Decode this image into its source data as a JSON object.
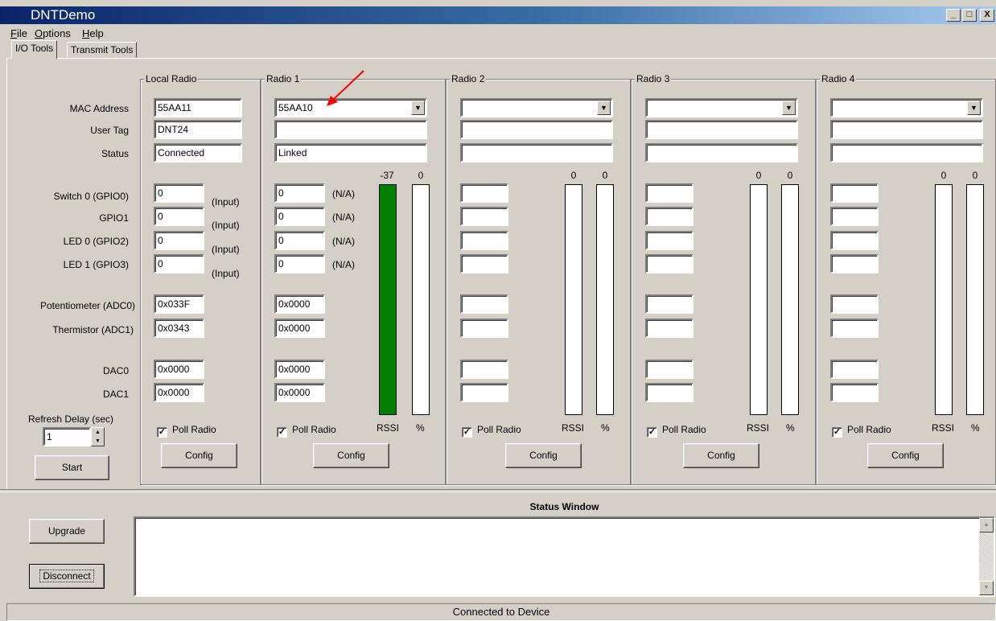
{
  "window": {
    "title": "DNTDemo",
    "minimize_glyph": "_",
    "maximize_glyph": "□",
    "close_glyph": "X"
  },
  "menu": [
    {
      "label": "File",
      "mnemonic": "F",
      "rest": "ile"
    },
    {
      "label": "Options",
      "mnemonic": "O",
      "rest": "ptions"
    },
    {
      "label": "Help",
      "mnemonic": "H",
      "rest": "elp"
    }
  ],
  "tabs": {
    "active": "I/O Tools",
    "other": "Transmit Tools"
  },
  "row_labels": {
    "mac_address": "MAC Address",
    "user_tag": "User Tag",
    "status": "Status",
    "gpio0": "Switch 0 (GPIO0)",
    "gpio1": "GPIO1",
    "gpio2": "LED 0 (GPIO2)",
    "gpio3": "LED 1 (GPIO3)",
    "adc0": "Potentiometer (ADC0)",
    "adc1": "Thermistor (ADC1)",
    "dac0": "DAC0",
    "dac1": "DAC1",
    "refresh_delay": "Refresh Delay (sec)"
  },
  "refresh": {
    "value": "1",
    "start_label": "Start"
  },
  "local_radio": {
    "title": "Local Radio",
    "mac": "55AA11",
    "user_tag": "DNT24",
    "status": "Connected",
    "gpio": [
      "0",
      "0",
      "0",
      "0"
    ],
    "gpio_mode": [
      "(Input)",
      "(Input)",
      "(Input)",
      "(Input)"
    ],
    "adc": [
      "0x033F",
      "0x0343"
    ],
    "dac": [
      "0x0000",
      "0x0000"
    ],
    "poll_label": "Poll Radio",
    "poll_checked": true,
    "check_glyph": "✓",
    "config_label": "Config"
  },
  "radios": [
    {
      "title": "Radio 1",
      "mac": "55AA10",
      "user_tag": "",
      "status": "Linked",
      "gpio": [
        "0",
        "0",
        "0",
        "0"
      ],
      "gpio_mode": [
        "(N/A)",
        "(N/A)",
        "(N/A)",
        "(N/A)"
      ],
      "adc": [
        "0x0000",
        "0x0000"
      ],
      "dac": [
        "0x0000",
        "0x0000"
      ],
      "rssi_value": "-37",
      "percent_value": "0",
      "rssi_fill": 1.0,
      "percent_fill": 0,
      "rssi_label": "RSSI",
      "percent_label": "%",
      "poll_label": "Poll Radio",
      "poll_checked": true,
      "config_label": "Config"
    },
    {
      "title": "Radio 2",
      "mac": "",
      "user_tag": "",
      "status": "",
      "gpio": [
        "",
        "",
        "",
        ""
      ],
      "gpio_mode": [
        "",
        "",
        "",
        ""
      ],
      "adc": [
        "",
        ""
      ],
      "dac": [
        "",
        ""
      ],
      "rssi_value": "0",
      "percent_value": "0",
      "rssi_fill": 0,
      "percent_fill": 0,
      "rssi_label": "RSSI",
      "percent_label": "%",
      "poll_label": "Poll Radio",
      "poll_checked": true,
      "config_label": "Config"
    },
    {
      "title": "Radio 3",
      "mac": "",
      "user_tag": "",
      "status": "",
      "gpio": [
        "",
        "",
        "",
        ""
      ],
      "gpio_mode": [
        "",
        "",
        "",
        ""
      ],
      "adc": [
        "",
        ""
      ],
      "dac": [
        "",
        ""
      ],
      "rssi_value": "0",
      "percent_value": "0",
      "rssi_fill": 0,
      "percent_fill": 0,
      "rssi_label": "RSSI",
      "percent_label": "%",
      "poll_label": "Poll Radio",
      "poll_checked": true,
      "config_label": "Config"
    },
    {
      "title": "Radio 4",
      "mac": "",
      "user_tag": "",
      "status": "",
      "gpio": [
        "",
        "",
        "",
        ""
      ],
      "gpio_mode": [
        "",
        "",
        "",
        ""
      ],
      "adc": [
        "",
        ""
      ],
      "dac": [
        "",
        ""
      ],
      "rssi_value": "0",
      "percent_value": "0",
      "rssi_fill": 0,
      "percent_fill": 0,
      "rssi_label": "RSSI",
      "percent_label": "%",
      "poll_label": "Poll Radio",
      "poll_checked": true,
      "config_label": "Config"
    }
  ],
  "status_window": {
    "title": "Status Window",
    "content": ""
  },
  "buttons": {
    "upgrade": "Upgrade",
    "disconnect": "Disconnect"
  },
  "statusbar": {
    "text": "Connected to Device"
  },
  "colors": {
    "rssi_bar": "#008000",
    "annotation_arrow": "#ff0000"
  }
}
